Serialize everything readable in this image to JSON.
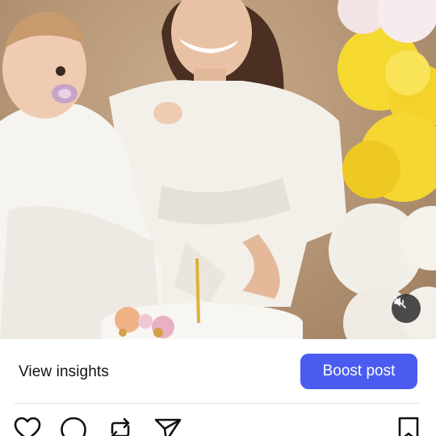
{
  "post": {
    "insights_label": "View insights",
    "boost_label": "Boost post"
  },
  "icons": {
    "mute": "volume-muted-icon",
    "like": "heart-icon",
    "comment": "comment-icon",
    "repost": "repost-icon",
    "share": "send-icon",
    "save": "bookmark-icon"
  },
  "colors": {
    "boost_button": "#4a5cf0",
    "balloon_yellow": "#f4d52e",
    "balloon_white": "#f2efe9"
  }
}
